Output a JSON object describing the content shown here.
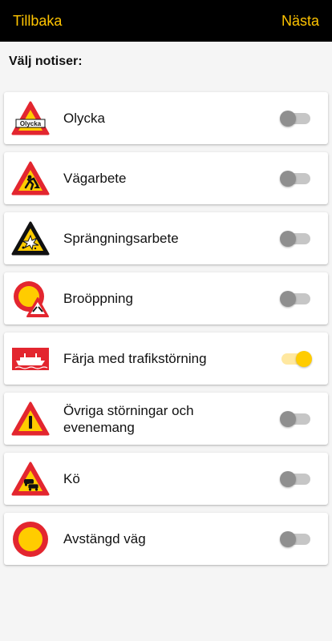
{
  "header": {
    "back_label": "Tillbaka",
    "next_label": "Nästa"
  },
  "heading": "Välj notiser:",
  "colors": {
    "accent": "#ffc400",
    "header_bg": "#000000",
    "sign_red": "#e3262f",
    "sign_yellow": "#ffcc00"
  },
  "notifications": [
    {
      "icon": "accident-warning-sign-icon",
      "sign_text": "Olycka",
      "label": "Olycka",
      "enabled": false
    },
    {
      "icon": "roadwork-warning-sign-icon",
      "label": "Vägarbete",
      "enabled": false
    },
    {
      "icon": "blasting-warning-sign-icon",
      "label": "Sprängningsarbete",
      "enabled": false
    },
    {
      "icon": "bridge-opening-sign-icon",
      "label": "Broöppning",
      "enabled": false
    },
    {
      "icon": "ferry-sign-icon",
      "label": "Färja med trafikstörning",
      "enabled": true
    },
    {
      "icon": "other-danger-sign-icon",
      "label": "Övriga störningar och evenemang",
      "enabled": false
    },
    {
      "icon": "queue-warning-sign-icon",
      "label": "Kö",
      "enabled": false
    },
    {
      "icon": "road-closed-sign-icon",
      "label": "Avstängd väg",
      "enabled": false
    }
  ]
}
